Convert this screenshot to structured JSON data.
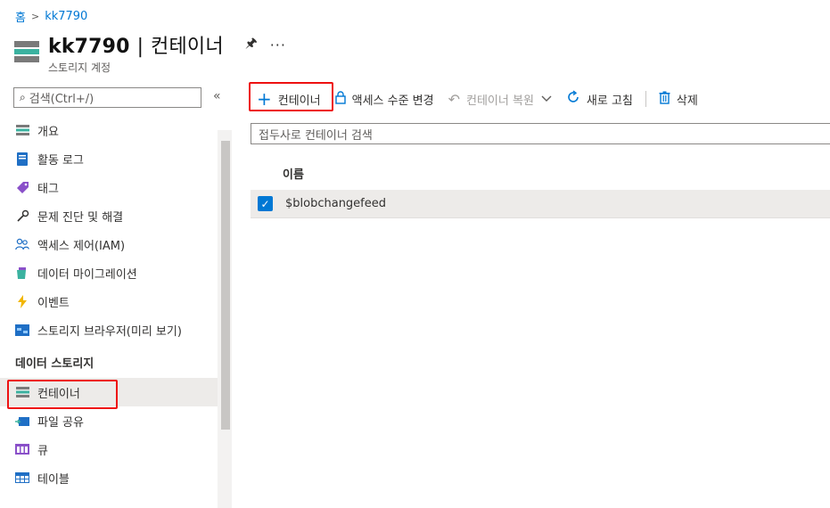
{
  "breadcrumb": {
    "home": "홈",
    "current": "kk7790"
  },
  "header": {
    "title_resource": "kk7790",
    "title_separator": "|",
    "title_page": "컨테이너",
    "subtitle": "스토리지 계정",
    "more": "···"
  },
  "sidebar": {
    "search_placeholder": "검색(Ctrl+/)",
    "collapse": "«",
    "items": [
      {
        "label": "개요",
        "icon": "storage-icon"
      },
      {
        "label": "활동 로그",
        "icon": "activity-log-icon"
      },
      {
        "label": "태그",
        "icon": "tag-icon"
      },
      {
        "label": "문제 진단 및 해결",
        "icon": "wrench-icon"
      },
      {
        "label": "액세스 제어(IAM)",
        "icon": "people-icon"
      },
      {
        "label": "데이터 마이그레이션",
        "icon": "migration-icon"
      },
      {
        "label": "이벤트",
        "icon": "lightning-icon"
      },
      {
        "label": "스토리지 브라우저(미리 보기)",
        "icon": "storage-browser-icon"
      }
    ],
    "section_data_storage": "데이터 스토리지",
    "data_items": [
      {
        "label": "컨테이너",
        "icon": "container-icon",
        "selected": true
      },
      {
        "label": "파일 공유",
        "icon": "file-share-icon"
      },
      {
        "label": "큐",
        "icon": "queue-icon"
      },
      {
        "label": "테이블",
        "icon": "table-icon"
      }
    ]
  },
  "toolbar": {
    "add_container": "컨테이너",
    "access_level": "액세스 수준 변경",
    "restore": "컨테이너 복원",
    "refresh": "새로 고침",
    "delete": "삭제"
  },
  "main": {
    "filter_placeholder": "접두사로 컨테이너 검색",
    "column_name": "이름",
    "rows": [
      {
        "name": "$blobchangefeed",
        "checked": true
      }
    ]
  },
  "colors": {
    "accent": "#0078d4",
    "highlight": "#e81123",
    "selected_bg": "#edebe9"
  }
}
